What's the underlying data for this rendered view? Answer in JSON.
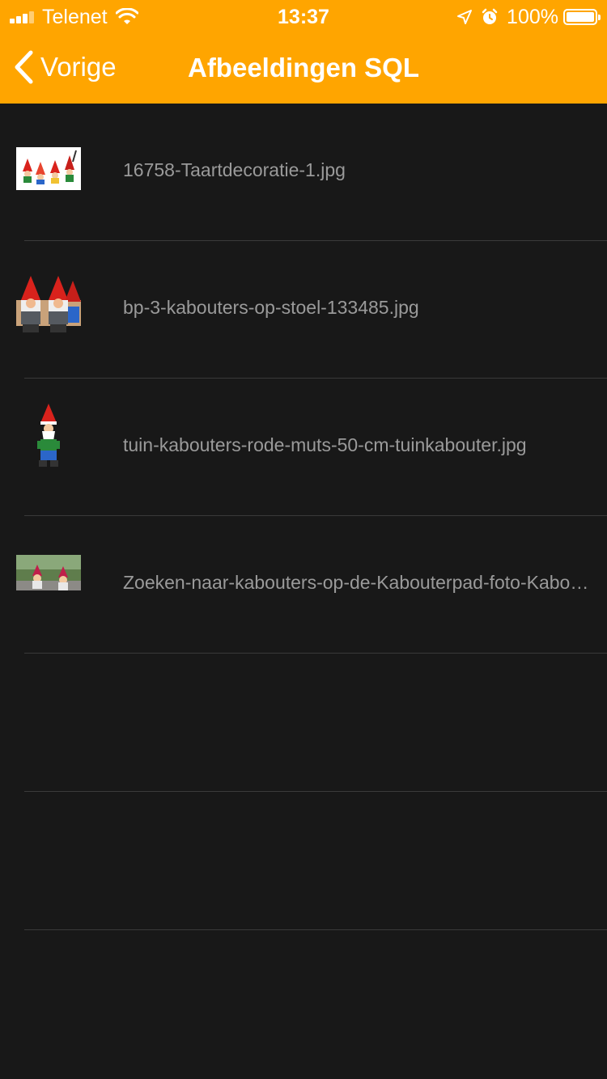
{
  "status_bar": {
    "carrier": "Telenet",
    "time": "13:37",
    "battery_percent": "100%",
    "battery_level": 1.0,
    "signal_bars": 4
  },
  "nav": {
    "back_label": "Vorige",
    "title": "Afbeeldingen SQL"
  },
  "colors": {
    "accent": "#FFA500",
    "background": "#181818",
    "separator": "#3a3a3a",
    "row_text": "#9a9a9a"
  },
  "list": {
    "items": [
      {
        "label": "16758-Taartdecoratie-1.jpg"
      },
      {
        "label": "bp-3-kabouters-op-stoel-133485.jpg"
      },
      {
        "label": "tuin-kabouters-rode-muts-50-cm-tuinkabouter.jpg"
      },
      {
        "label": "Zoeken-naar-kabouters-op-de-Kabouterpad-foto-Kabouterpad.jpg"
      }
    ]
  }
}
